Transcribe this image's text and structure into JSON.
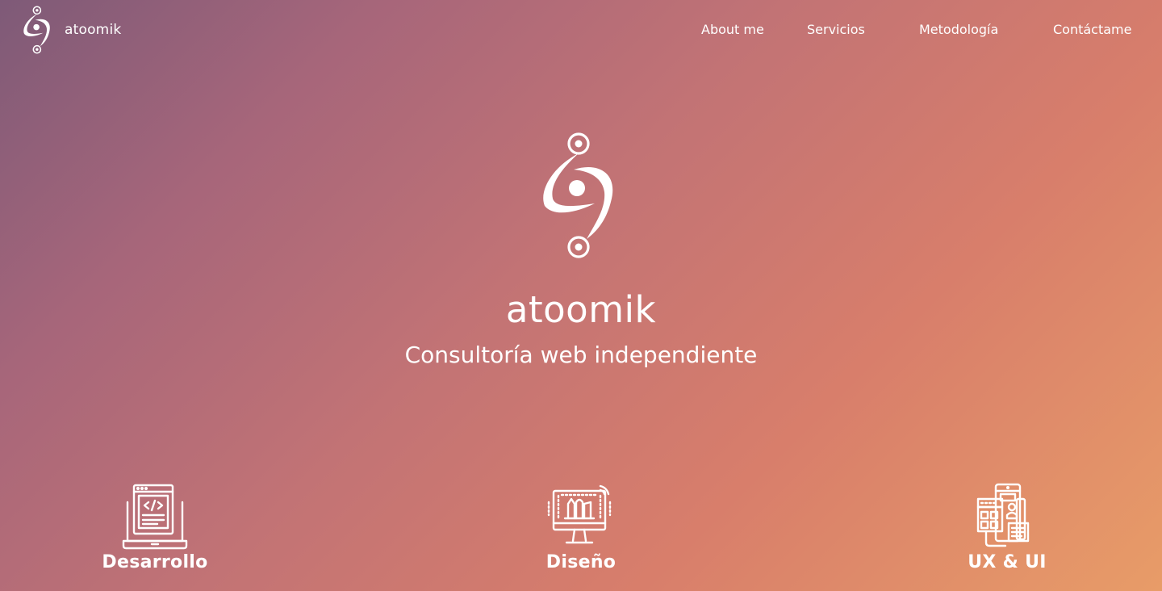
{
  "brand": {
    "name": "atoomik",
    "logo_icon": "atoomik-spiral-logo-icon"
  },
  "nav": {
    "items": [
      {
        "label": "About me"
      },
      {
        "label": "Servicios"
      },
      {
        "label": "Metodología"
      },
      {
        "label": "Contáctame"
      }
    ]
  },
  "hero": {
    "logo_icon": "atoomik-spiral-logo-icon",
    "title": "atoomik",
    "subtitle": "Consultoría web independiente"
  },
  "services": [
    {
      "label": "Desarrollo",
      "icon": "laptop-code-icon"
    },
    {
      "label": "Diseño",
      "icon": "monitor-design-tools-icon"
    },
    {
      "label": "UX & UI",
      "icon": "wireframe-layout-icon"
    }
  ],
  "colors": {
    "gradient_start": "#7e5a78",
    "gradient_mid": "#c27375",
    "gradient_end": "#e89c68",
    "text": "#ffffff"
  }
}
